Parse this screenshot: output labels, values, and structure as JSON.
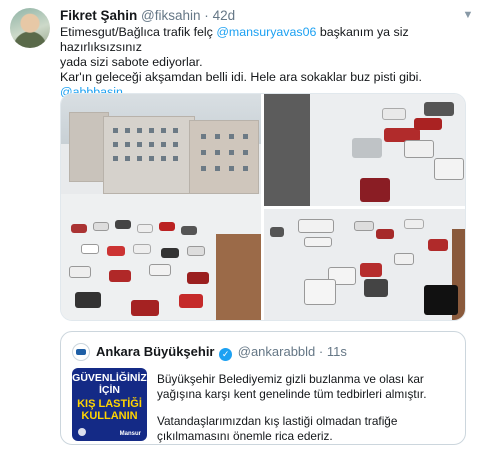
{
  "tweet": {
    "author_name": "Fikret Şahin",
    "author_handle": "@fiksahin",
    "separator": "·",
    "time": "42d",
    "text_line1_pre": "Etimesgut/Bağlıca trafik felç ",
    "text_line1_mention": "@mansuryavas06",
    "text_line1_post": " başkanım ya siz hazırlıksızsınız",
    "text_line2": "yada sizi sabote ediyorlar.",
    "text_line3": "Kar'ın geleceği akşamdan belli idi. Hele ara sokaklar buz pisti gibi.",
    "text_mention2": "@abbbasin",
    "more_icon": "chevron-down-icon"
  },
  "quoted_tweet": {
    "author_name": "Ankara Büyükşehir",
    "author_handle": "@ankarabbld",
    "separator": "·",
    "time": "11s",
    "verified_icon": "verified-badge-icon",
    "paragraph1": "Büyükşehir Belediyemiz gizli buzlanma ve olası kar yağışına karşı kent genelinde tüm tedbirleri almıştır.",
    "paragraph2": "Vatandaşlarımızdan kış lastiği olmadan trafiğe çıkılmamasını önemle rica ederiz.",
    "image": {
      "line1": "GÜVENLİĞİNİZ",
      "line2": "İÇİN",
      "line3": "KIŞ LASTİĞİ",
      "line4": "KULLANIN",
      "signature": "Mansur",
      "background": "#142a86",
      "accent": "#ffd400"
    }
  },
  "colors": {
    "link": "#1da1f2",
    "muted": "#657786",
    "border": "#ccd6dd"
  }
}
